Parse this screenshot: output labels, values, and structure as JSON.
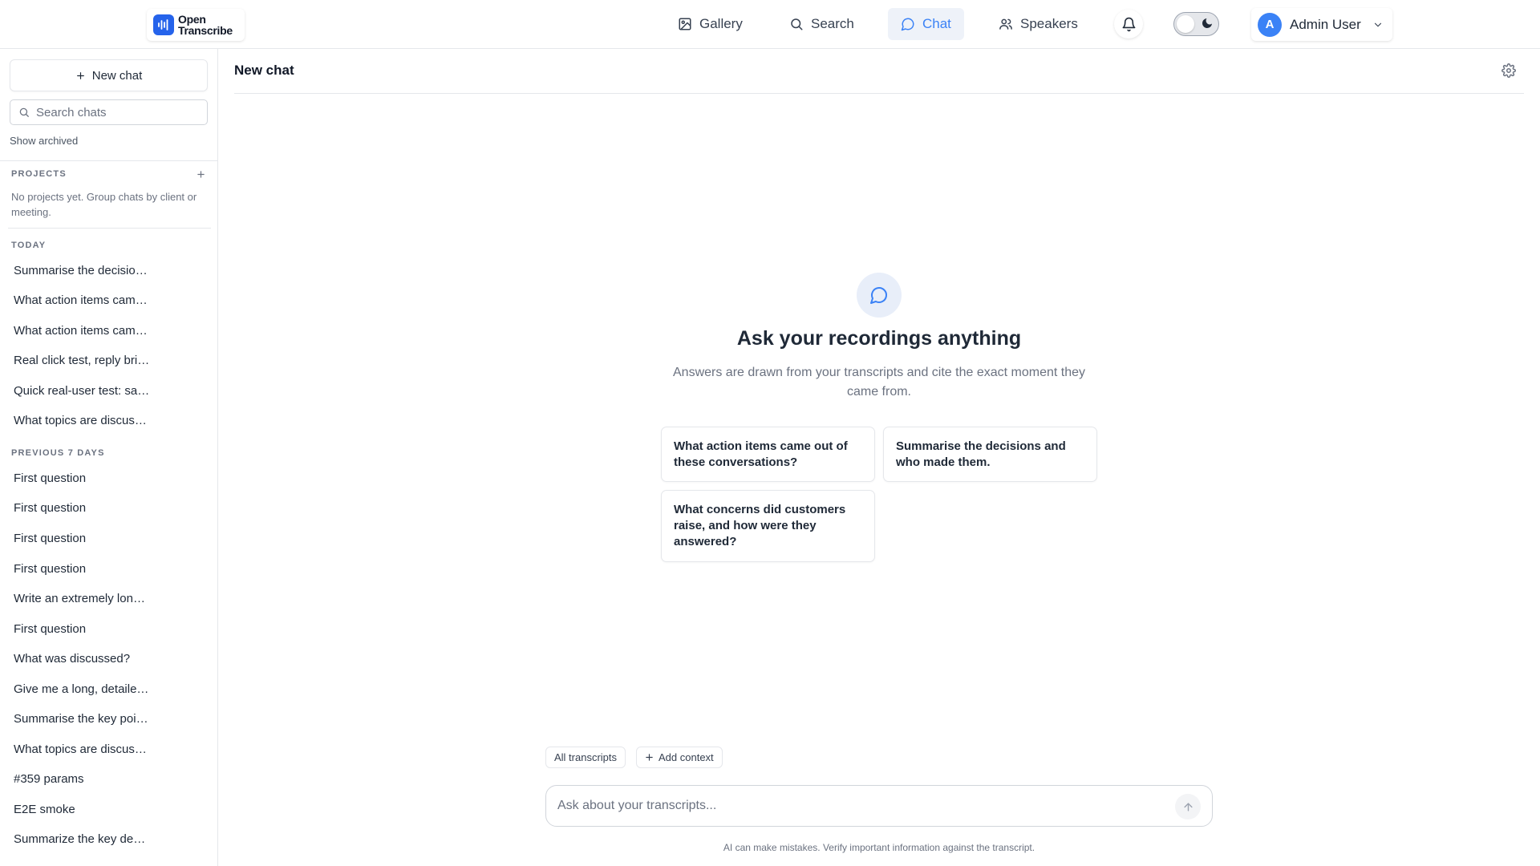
{
  "brand": {
    "line1": "Open",
    "line2": "Transcribe",
    "accent": "#2563eb"
  },
  "nav": {
    "gallery": "Gallery",
    "search": "Search",
    "chat": "Chat",
    "speakers": "Speakers"
  },
  "user": {
    "initial": "A",
    "name": "Admin User"
  },
  "sidebar": {
    "new_chat": "New chat",
    "search_placeholder": "Search chats",
    "show_archived": "Show archived",
    "projects_label": "PROJECTS",
    "projects_empty": "No projects yet. Group chats by client or meeting.",
    "today_label": "TODAY",
    "today": [
      "Summarise the decisions and who made them.",
      "What action items came out of these conversations?",
      "What action items came out of these conversations?",
      "Real click test, reply briefly",
      "Quick real-user test: say hello",
      "What topics are discussed?"
    ],
    "prev7_label": "PREVIOUS 7 DAYS",
    "previous": [
      "First question",
      "First question",
      "First question",
      "First question",
      "Write an extremely long answer",
      "First question",
      "What was discussed?",
      "Give me a long, detailed answer",
      "Summarise the key points",
      "What topics are discussed?",
      "#359 params",
      "E2E smoke",
      "Summarize the key decisions"
    ]
  },
  "main": {
    "title": "New chat",
    "hero_title": "Ask your recordings anything",
    "hero_sub": "Answers are drawn from your transcripts and cite the exact moment they came from.",
    "suggestions": [
      "What action items came out of these conversations?",
      "Summarise the decisions and who made them.",
      "What concerns did customers raise, and how were they answered?"
    ],
    "chip_all": "All transcripts",
    "chip_add": "Add context",
    "composer_placeholder": "Ask about your transcripts...",
    "disclaimer": "AI can make mistakes. Verify important information against the transcript."
  }
}
